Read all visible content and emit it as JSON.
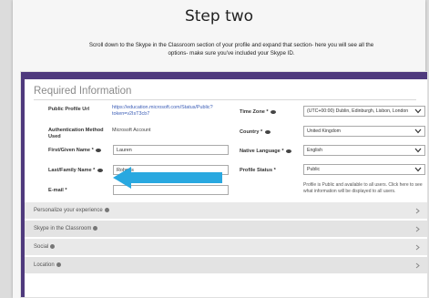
{
  "heading": "Step two",
  "instructions": "Scroll down to the Skype in the Classroom section of your profile and expand that section- here you will see all the options- make sure you've included your Skype ID.",
  "colors": {
    "accent": "#4f3a7d",
    "arrow": "#29a8e0",
    "link": "#3a5cb6"
  },
  "required": {
    "title": "Required Information",
    "public_profile_label": "Public Profile Url",
    "public_profile_url": "https://education.microsoft.com/Status/Public?token=v2IsT3cb7",
    "auth_label": "Authentication Method Used",
    "auth_value": "Microsoft Account",
    "first_name_label": "First/Given Name *",
    "first_name_value": "Lauren",
    "last_name_label": "Last/Family Name *",
    "last_name_value": "Roberts",
    "email_label": "E-mail *",
    "email_value": "",
    "timezone_label": "Time Zone *",
    "timezone_value": "(UTC+00:00) Dublin, Edinburgh, Lisbon, London",
    "country_label": "Country *",
    "country_value": "United Kingdom",
    "language_label": "Native Language *",
    "language_value": "English",
    "status_label": "Profile Status *",
    "status_value": "Public",
    "status_note": "Profile is Public and available to all users. Click here to see what information will be displayed to all users."
  },
  "accordion": [
    {
      "label": "Personalize your experience"
    },
    {
      "label": "Skype in the Classroom"
    },
    {
      "label": "Social"
    },
    {
      "label": "Location"
    }
  ]
}
